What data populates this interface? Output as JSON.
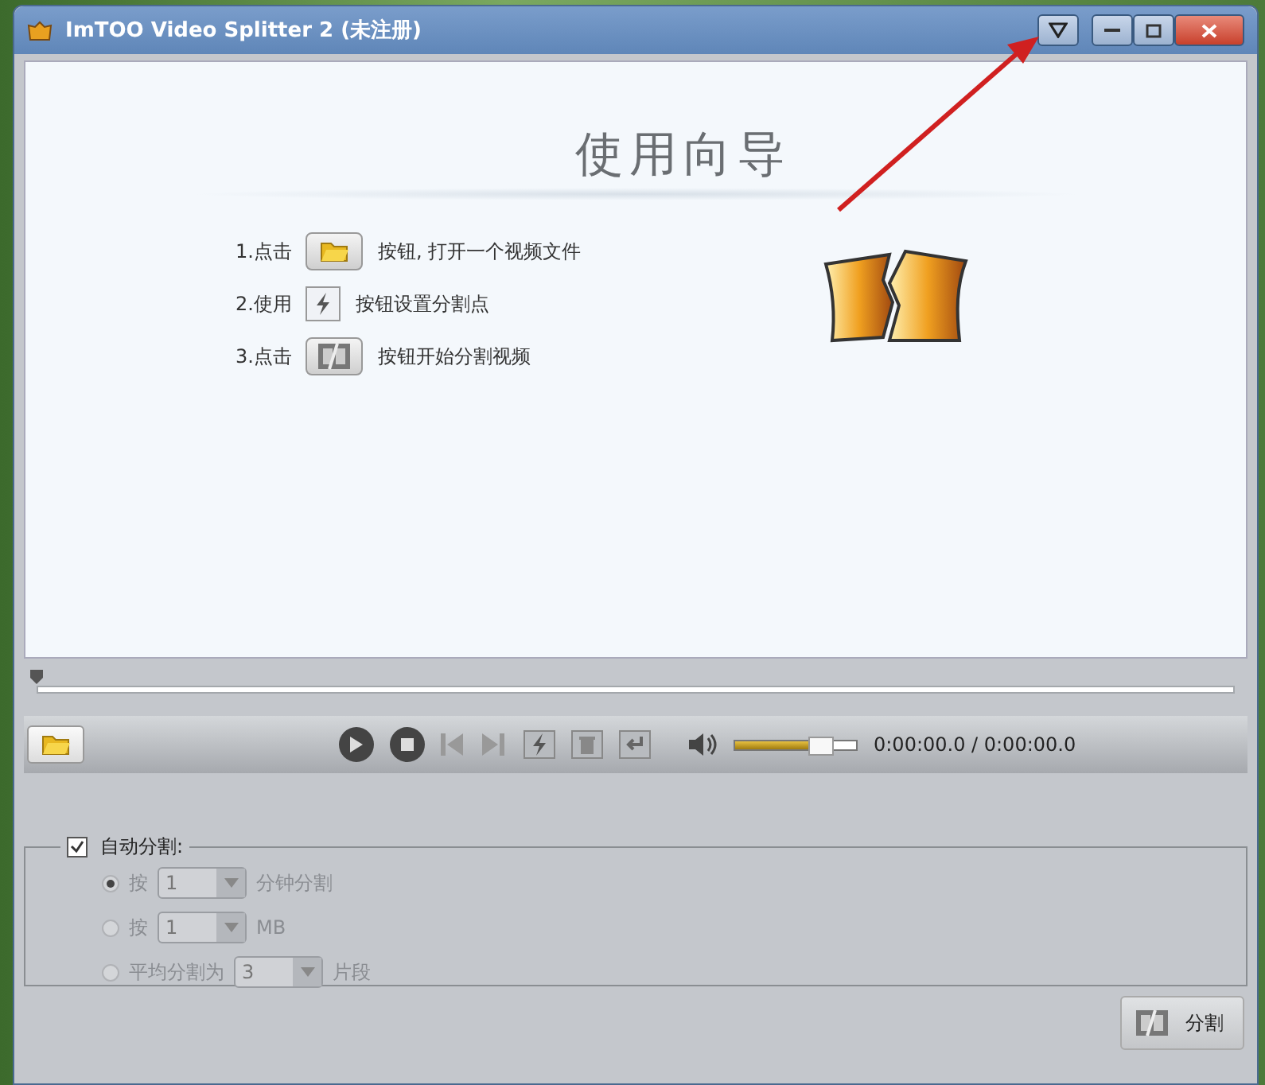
{
  "window": {
    "title": "ImTOO Video Splitter 2 (未注册)"
  },
  "guide": {
    "title": "使用向导",
    "steps": [
      {
        "prefix": "1.点击",
        "kind": "open",
        "suffix": "按钮, 打开一个视频文件"
      },
      {
        "prefix": "2.使用",
        "kind": "mark",
        "suffix": "按钮设置分割点"
      },
      {
        "prefix": "3.点击",
        "kind": "split",
        "suffix": "按钮开始分割视频"
      }
    ]
  },
  "timeline": {
    "level": 0
  },
  "player": {
    "volume": {
      "level": 0.7
    },
    "time": "0:00:00.0 / 0:00:00.0"
  },
  "auto_split": {
    "label": "自动分割:",
    "checked": true,
    "options": [
      {
        "prefix": "按",
        "value": "1",
        "suffix": "分钟分割",
        "selected": true,
        "disabled": true
      },
      {
        "prefix": "按",
        "value": "1",
        "suffix": "MB",
        "selected": false,
        "disabled": true
      },
      {
        "prefix": "平均分割为",
        "value": "3",
        "suffix": "片段",
        "selected": false,
        "disabled": true
      }
    ]
  },
  "split_button": {
    "label": "分割"
  }
}
